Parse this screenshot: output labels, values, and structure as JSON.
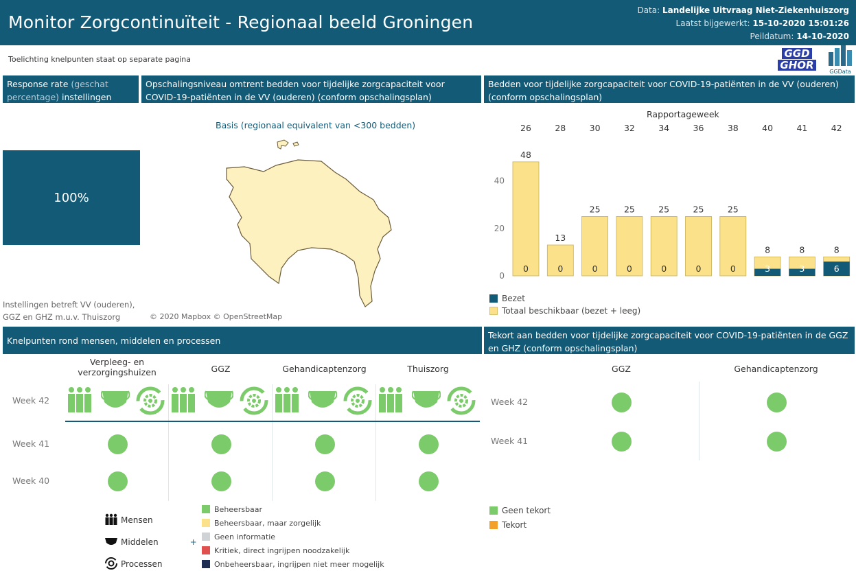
{
  "header": {
    "title": "Monitor Zorgcontinuïteit - Regionaal beeld Groningen",
    "data_label": "Data:",
    "data_value": "Landelijke Uitvraag Niet-Ziekenhuiszorg",
    "updated_label": "Laatst bijgewerkt:",
    "updated_value": "15-10-2020 15:01:26",
    "peildatum_label": "Peildatum:",
    "peildatum_value": "14-10-2020"
  },
  "note": "Toelichting knelpunten staat op separate pagina",
  "logos": {
    "ggd_top": "GGD",
    "ggd_bottom": "GHOR",
    "ggdata": "GGData"
  },
  "response": {
    "header_a": "Response rate",
    "header_b": "(geschat percentage)",
    "header_c": "instellingen",
    "value": "100%",
    "footnote_1": "Instellingen betreft VV (ouderen),",
    "footnote_2": "GGZ en GHZ m.u.v. Thuiszorg"
  },
  "map": {
    "header": "Opschalingsniveau omtrent bedden voor tijdelijke zorgcapaciteit voor COVID-19-patiënten in de VV (ouderen) (conform opschalingsplan)",
    "level_label": "Basis (regionaal equivalent van <300 bedden)",
    "attribution": "© 2020 Mapbox © OpenStreetMap",
    "fill_color": "#fdf1bf"
  },
  "chart_data": {
    "type": "bar",
    "title": "Bedden voor tijdelijke zorgcapaciteit voor COVID-19-patiënten in de VV (ouderen) (conform opschalingsplan)",
    "xlabel": "Rapportageweek",
    "categories": [
      "26",
      "28",
      "30",
      "32",
      "34",
      "36",
      "38",
      "40",
      "41",
      "42"
    ],
    "series": [
      {
        "name": "Totaal beschikbaar (bezet + leeg)",
        "color": "#fbe28a",
        "values": [
          48,
          13,
          25,
          25,
          25,
          25,
          25,
          8,
          8,
          8
        ]
      },
      {
        "name": "Bezet",
        "color": "#135a77",
        "values": [
          0,
          0,
          0,
          0,
          0,
          0,
          0,
          3,
          3,
          6
        ]
      }
    ],
    "yticks": [
      0,
      20,
      40
    ],
    "ylim": [
      0,
      52
    ],
    "legend": "bottom-left"
  },
  "knelpunten": {
    "header": "Knelpunten rond mensen, middelen en processen",
    "columns": [
      "Verpleeg- en verzorgingshuizen",
      "GGZ",
      "Gehandicaptenzorg",
      "Thuiszorg"
    ],
    "weeks": [
      "Week 42",
      "Week 41",
      "Week 40"
    ],
    "icons": [
      "people-icon",
      "mask-icon",
      "gear-cycle-icon"
    ],
    "legend_icons": [
      {
        "label": "Mensen",
        "icon": "people-icon"
      },
      {
        "label": "Middelen",
        "icon": "mask-icon"
      },
      {
        "label": "Processen",
        "icon": "gear-cycle-icon"
      }
    ],
    "plus": "+",
    "status_legend": [
      {
        "label": "Beheersbaar",
        "color": "#7ccb6a"
      },
      {
        "label": "Beheersbaar, maar zorgelijk",
        "color": "#fbe28a"
      },
      {
        "label": "Geen informatie",
        "color": "#cfd3d5"
      },
      {
        "label": "Kritiek, direct ingrijpen noodzakelijk",
        "color": "#e0504f"
      },
      {
        "label": "Onbeheersbaar, ingrijpen niet meer mogelijk",
        "color": "#1d2e52"
      }
    ]
  },
  "tekort": {
    "header": "Tekort aan bedden voor tijdelijke zorgcapaciteit voor COVID-19-patiënten in de GGZ en GHZ (conform opschalingsplan)",
    "columns": [
      "GGZ",
      "Gehandicaptenzorg"
    ],
    "weeks": [
      "Week 42",
      "Week 41"
    ],
    "legend": [
      {
        "label": "Geen tekort",
        "color": "#7ccb6a"
      },
      {
        "label": "Tekort",
        "color": "#f2a12b"
      }
    ]
  }
}
